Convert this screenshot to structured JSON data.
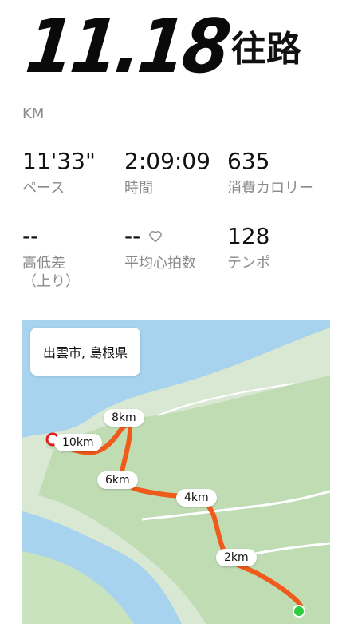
{
  "header": {
    "distance": "11.18",
    "route_label": "往路",
    "unit": "KM"
  },
  "stats": {
    "pace": {
      "value": "11'33\"",
      "label": "ペース"
    },
    "time": {
      "value": "2:09:09",
      "label": "時間"
    },
    "calories": {
      "value": "635",
      "label": "消費カロリー"
    },
    "elevation": {
      "value": "--",
      "label": "高低差\n（上り）"
    },
    "heart_rate": {
      "value": "--",
      "label": "平均心拍数",
      "icon": "heart-outline-icon"
    },
    "cadence": {
      "value": "128",
      "label": "テンポ"
    }
  },
  "map": {
    "place": "出雲市, 島根県",
    "route_color": "#f05a1a",
    "start_marker_color": "#2ecc40",
    "end_marker_color": "#e02020",
    "km_markers": [
      "2km",
      "4km",
      "6km",
      "8km",
      "10km"
    ]
  }
}
